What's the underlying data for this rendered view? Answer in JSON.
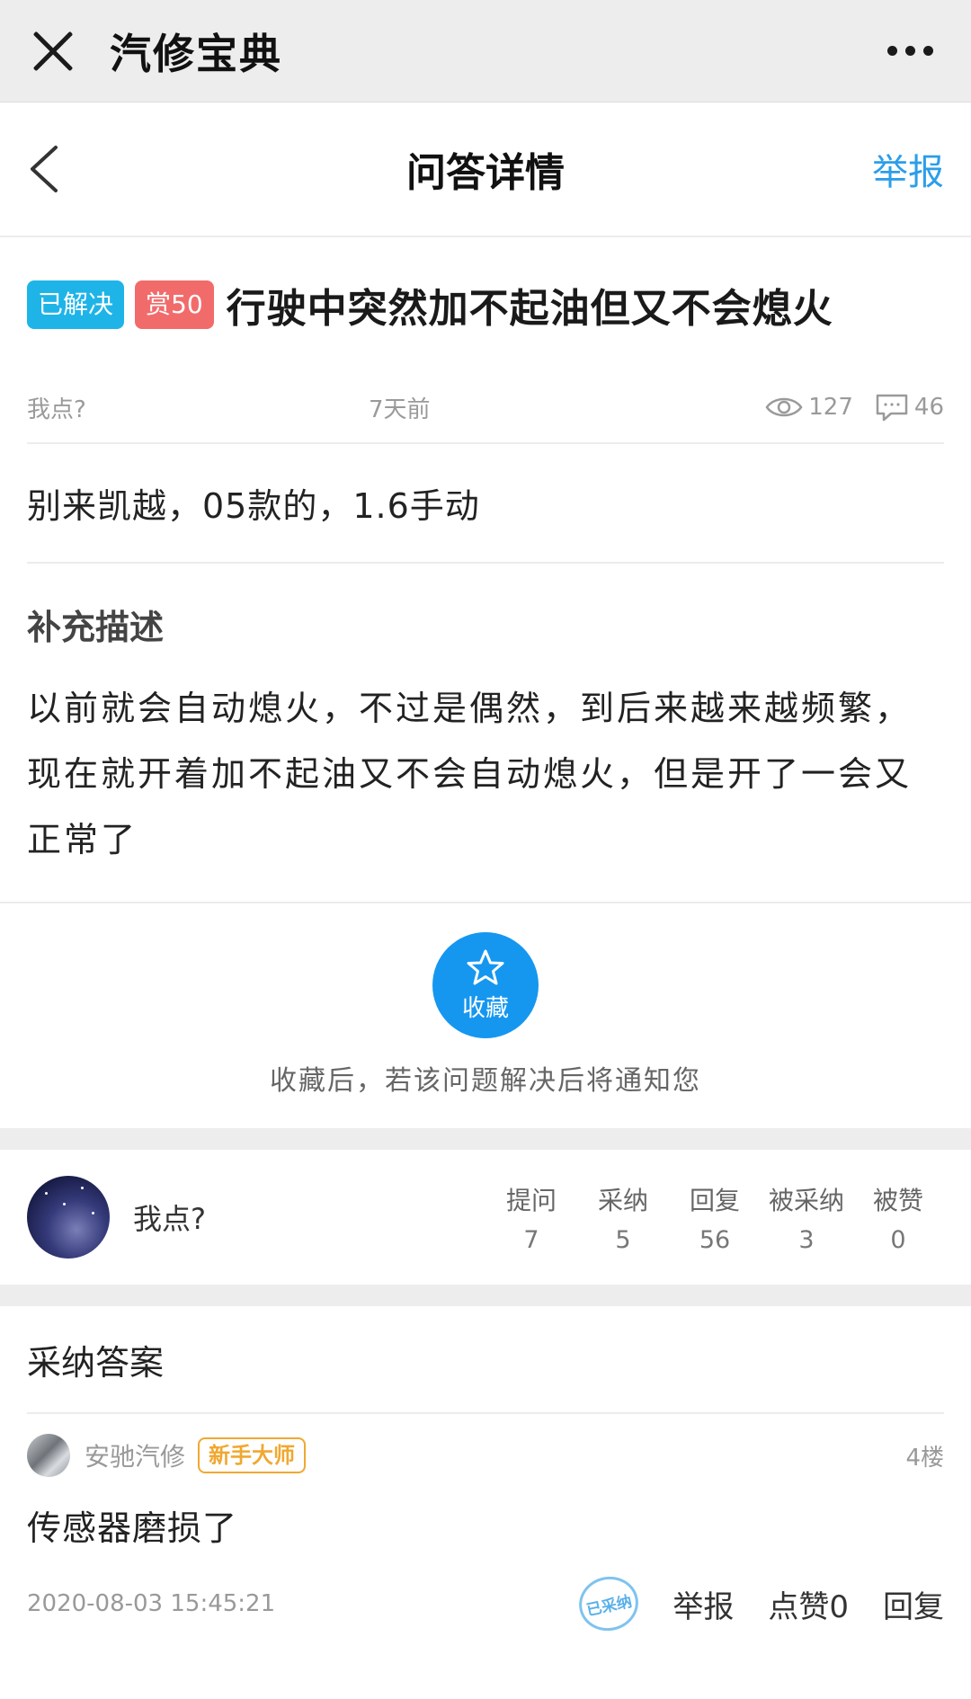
{
  "wechat": {
    "title": "汽修宝典"
  },
  "nav": {
    "title": "问答详情",
    "report": "举报"
  },
  "question": {
    "tags": {
      "solved": "已解决",
      "reward": "赏50"
    },
    "title": "行驶中突然加不起油但又不会熄火",
    "author": "我点?",
    "time": "7天前",
    "views": "127",
    "comments": "46",
    "body": "别来凯越，05款的，1.6手动",
    "supplement_title": "补充描述",
    "supplement_body": "以前就会自动熄火，不过是偶然，到后来越来越频繁，现在就开着加不起油又不会自动熄火，但是开了一会又正常了"
  },
  "favorite": {
    "label": "收藏",
    "tip": "收藏后，若该问题解决后将通知您"
  },
  "user": {
    "name": "我点?",
    "stats": [
      {
        "label": "提问",
        "value": "7"
      },
      {
        "label": "采纳",
        "value": "5"
      },
      {
        "label": "回复",
        "value": "56"
      },
      {
        "label": "被采纳",
        "value": "3"
      },
      {
        "label": "被赞",
        "value": "0"
      }
    ]
  },
  "answers": {
    "heading": "采纳答案",
    "items": [
      {
        "name": "安驰汽修",
        "badge": "新手大师",
        "floor": "4楼",
        "text": "传感器磨损了",
        "time": "2020-08-03 15:45:21",
        "stamp": "已采纳",
        "report": "举报",
        "like": "点赞0",
        "reply": "回复"
      }
    ]
  }
}
